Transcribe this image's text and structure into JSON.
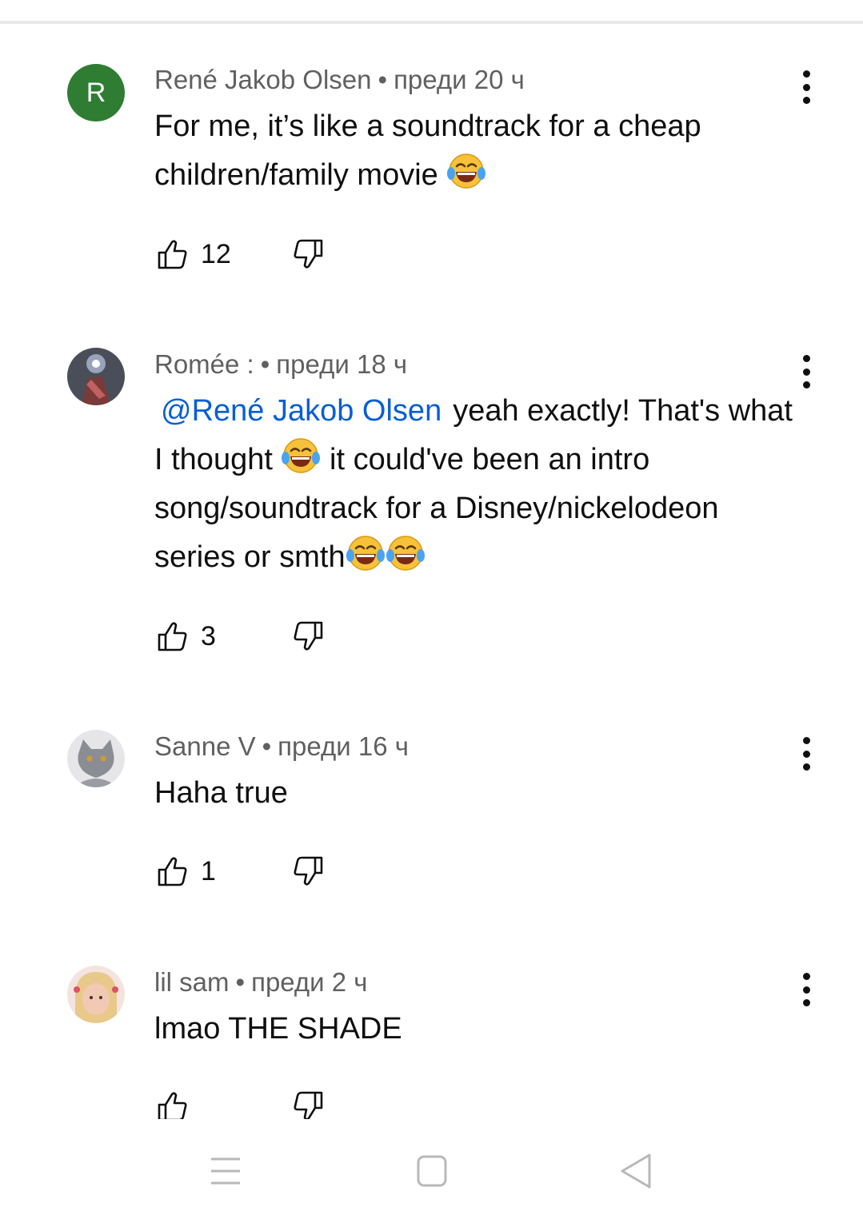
{
  "comments": [
    {
      "author": "René Jakob Olsen",
      "time": "преди 20 ч",
      "avatar_letter": "R",
      "text_before": "For me, it’s like a soundtrack for a cheap children/family movie",
      "likes": "12"
    },
    {
      "author": "Romée :",
      "time": "преди 18 ч",
      "mention": "@René Jakob Olsen",
      "text_part1": "yeah exactly! That's what I thought",
      "text_part2": "it could've been an intro song/soundtrack for a Disney/nickelodeon series or smth",
      "likes": "3"
    },
    {
      "author": "Sanne V",
      "time": "преди 16 ч",
      "text": "Haha true",
      "likes": "1"
    },
    {
      "author": "lil sam",
      "time": "преди 2 ч",
      "text": "lmao THE SHADE",
      "likes": ""
    }
  ],
  "separator": "•",
  "icons": {
    "like": "thumbs-up-icon",
    "dislike": "thumbs-down-icon",
    "more": "more-vert-icon",
    "emoji": "face-with-tears-of-joy-emoji",
    "nav_menu": "recent-apps-icon",
    "nav_home": "home-icon",
    "nav_back": "back-icon"
  },
  "colors": {
    "mention": "#065fd4",
    "meta": "#606060",
    "avatar_r": "#2e7d32"
  }
}
